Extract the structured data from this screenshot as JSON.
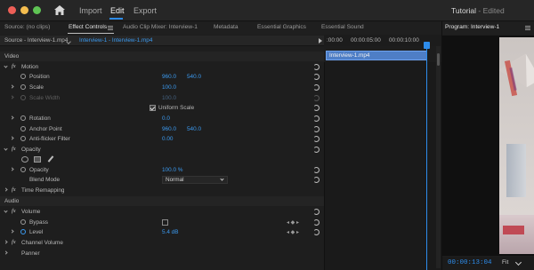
{
  "window": {
    "nav": [
      "Import",
      "Edit",
      "Export"
    ],
    "active_nav": "Edit",
    "title": "Tutorial",
    "title_status": "- Edited"
  },
  "panels": {
    "tabs": [
      "Source: (no clips)",
      "Effect Controls",
      "Audio Clip Mixer: Interview-1",
      "Metadata",
      "Essential Graphics",
      "Essential Sound"
    ],
    "active_tab": "Effect Controls",
    "program_title": "Program: Interview-1"
  },
  "effect_controls": {
    "source_label": "Source - Interview-1.mp4",
    "clip_label": "Interview-1 - Interview-1.mp4",
    "timeline": {
      "timecodes": [
        ":00:00",
        "00:00:05:00",
        "00:00:10:00"
      ],
      "clip_name": "Interview-1.mp4"
    },
    "video_section": "Video",
    "motion": {
      "label": "Motion",
      "position": {
        "label": "Position",
        "x": "960.0",
        "y": "540.0"
      },
      "scale": {
        "label": "Scale",
        "value": "100.0"
      },
      "scale_width": {
        "label": "Scale Width",
        "value": "100.0"
      },
      "uniform_scale": {
        "label": "Uniform Scale",
        "checked": true
      },
      "rotation": {
        "label": "Rotation",
        "value": "0.0"
      },
      "anchor_point": {
        "label": "Anchor Point",
        "x": "960.0",
        "y": "540.0"
      },
      "anti_flicker": {
        "label": "Anti-flicker Filter",
        "value": "0.00"
      }
    },
    "opacity": {
      "label": "Opacity",
      "opacity": {
        "label": "Opacity",
        "value": "100.0 %"
      },
      "blend_mode": {
        "label": "Blend Mode",
        "value": "Normal"
      }
    },
    "time_remapping": "Time Remapping",
    "audio_section": "Audio",
    "volume": {
      "label": "Volume",
      "bypass": {
        "label": "Bypass",
        "checked": false
      },
      "level": {
        "label": "Level",
        "value": "5.4 dB"
      }
    },
    "channel_volume": "Channel Volume",
    "panner": "Panner"
  },
  "program": {
    "timecode": "00:00:13:04",
    "fit": "Fit"
  },
  "colors": {
    "accent": "#2d8ceb",
    "value_blue": "#3b9af0",
    "clip_blue": "#4e7ec6"
  }
}
